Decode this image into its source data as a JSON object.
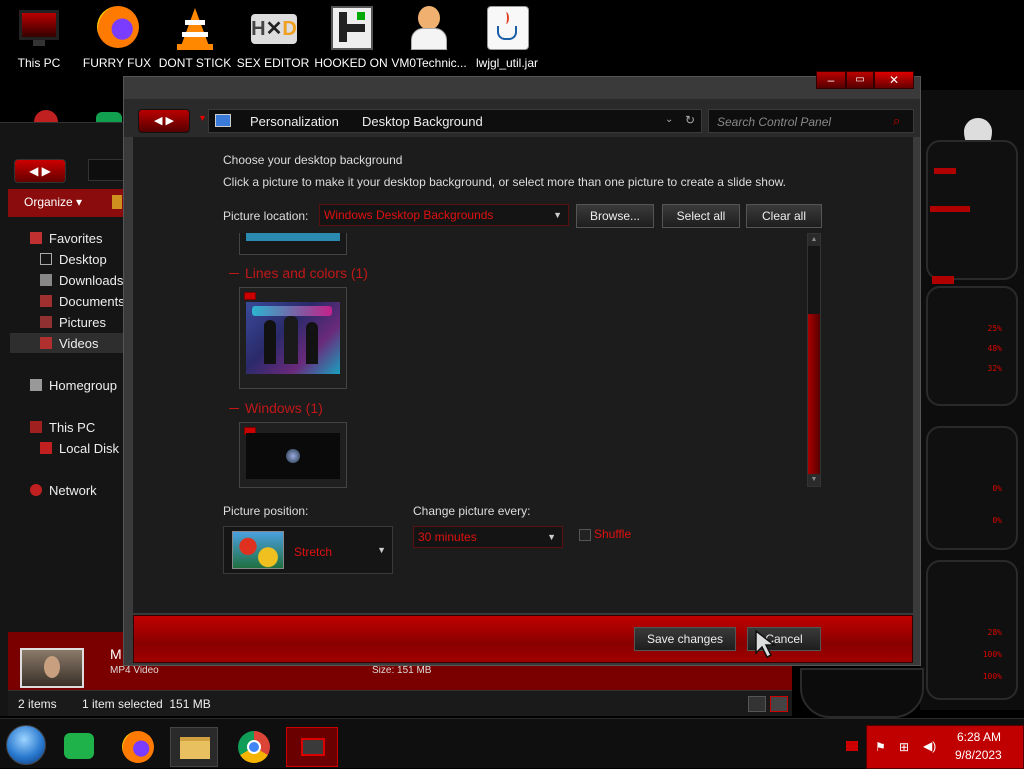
{
  "desktop_icons": [
    {
      "label": "This PC",
      "icon": "monitor-icon"
    },
    {
      "label": "FURRY FUX",
      "icon": "firefox-icon"
    },
    {
      "label": "DONT STICK",
      "icon": "vlc-cone-icon"
    },
    {
      "label": "SEX EDITOR",
      "icon": "hxd-icon"
    },
    {
      "label": "HOOKED ON",
      "icon": "app-icon"
    },
    {
      "label": "VM0Technic...",
      "icon": "doctor-icon"
    },
    {
      "label": "lwjgl_util.jar",
      "icon": "java-icon"
    }
  ],
  "dialog": {
    "breadcrumb": [
      "Personalization",
      "Desktop Background"
    ],
    "search_placeholder": "Search Control Panel",
    "heading": "Choose your desktop background",
    "instructions": "Click a picture to make it your desktop background, or select more than one picture to create a slide show.",
    "picture_location_label": "Picture location:",
    "picture_location_value": "Windows Desktop Backgrounds",
    "browse_label": "Browse...",
    "select_all_label": "Select all",
    "clear_all_label": "Clear all",
    "groups": [
      {
        "title": "Lines and colors (1)"
      },
      {
        "title": "Windows (1)"
      }
    ],
    "picture_position_label": "Picture position:",
    "picture_position_value": "Stretch",
    "change_every_label": "Change picture every:",
    "change_every_value": "30 minutes",
    "shuffle_label": "Shuffle",
    "save_label": "Save changes",
    "cancel_label": "Cancel"
  },
  "explorer": {
    "organize_label": "Organize",
    "nav": [
      {
        "label": "Favorites"
      },
      {
        "label": "Desktop"
      },
      {
        "label": "Downloads"
      },
      {
        "label": "Documents"
      },
      {
        "label": "Pictures"
      },
      {
        "label": "Videos"
      },
      {
        "label": "Homegroup"
      },
      {
        "label": "This PC"
      },
      {
        "label": "Local Disk"
      },
      {
        "label": "Network"
      }
    ],
    "detail_name": "M",
    "detail_type": "MP4 Video",
    "detail_size": "Size:   151 MB",
    "status_items": "2 items",
    "status_selected": "1 item selected  151 MB"
  },
  "alien_widget": {
    "percents": [
      "25%",
      "48%",
      "32%",
      "0%",
      "0%",
      "28%",
      "100%",
      "100%"
    ]
  },
  "taskbar": {
    "time": "6:28 AM",
    "date": "9/8/2023"
  },
  "colors": {
    "accent_red": "#c00000",
    "dialog_bg": "#1c1c1c"
  }
}
